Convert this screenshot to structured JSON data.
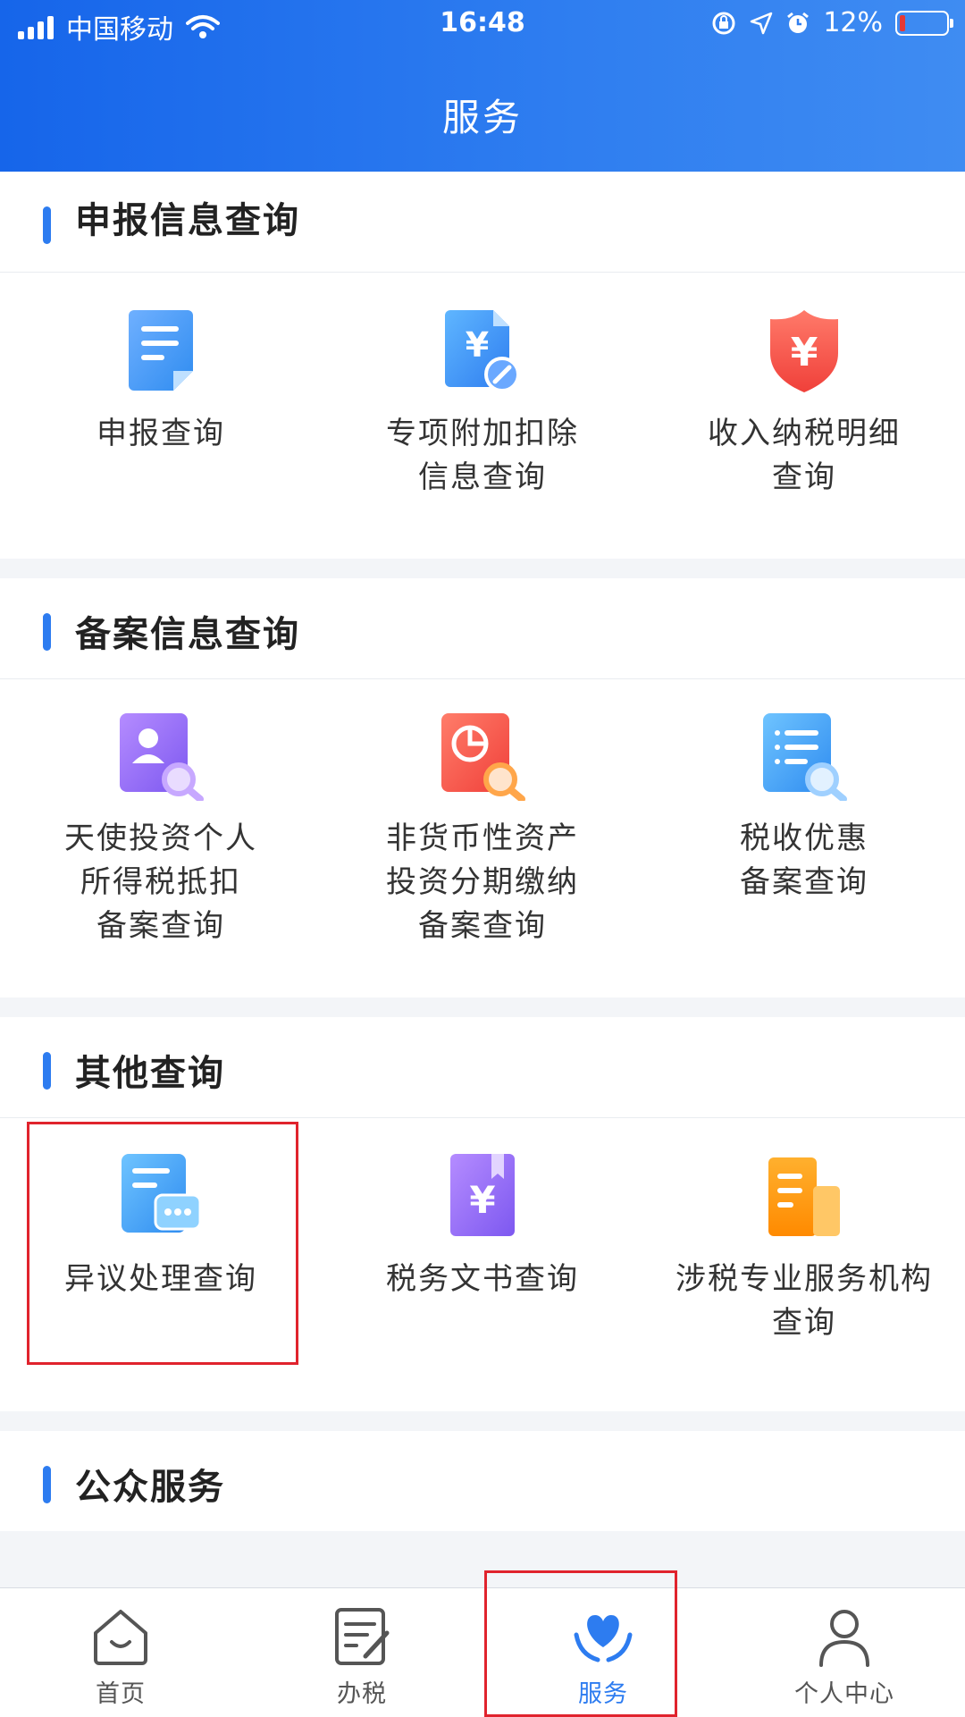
{
  "status_bar": {
    "carrier": "中国移动",
    "time": "16:48",
    "battery": "12%",
    "battery_level": 0.12
  },
  "header": {
    "title": "服务"
  },
  "sections": [
    {
      "title": "申报信息查询",
      "items": [
        {
          "label": "申报查询",
          "icon": "document-icon"
        },
        {
          "label": "专项附加扣除\n信息查询",
          "icon": "yuan-document-edit-icon"
        },
        {
          "label": "收入纳税明细\n查询",
          "icon": "yuan-shield-icon"
        }
      ]
    },
    {
      "title": "备案信息查询",
      "items": [
        {
          "label": "天使投资个人\n所得税抵扣\n备案查询",
          "icon": "person-search-icon"
        },
        {
          "label": "非货币性资产\n投资分期缴纳\n备案查询",
          "icon": "pie-chart-search-icon"
        },
        {
          "label": "税收优惠\n备案查询",
          "icon": "list-search-icon"
        }
      ]
    },
    {
      "title": "其他查询",
      "items": [
        {
          "label": "异议处理查询",
          "icon": "document-chat-icon"
        },
        {
          "label": "税务文书查询",
          "icon": "yuan-book-icon"
        },
        {
          "label": "涉税专业服务机构\n查询",
          "icon": "building-icon"
        }
      ]
    },
    {
      "title": "公众服务",
      "items": []
    }
  ],
  "tabbar": {
    "tabs": [
      {
        "label": "首页",
        "icon": "home-icon",
        "active": false
      },
      {
        "label": "办税",
        "icon": "edit-document-icon",
        "active": false
      },
      {
        "label": "服务",
        "icon": "heart-hands-icon",
        "active": true
      },
      {
        "label": "个人中心",
        "icon": "user-icon",
        "active": false
      }
    ]
  },
  "colors": {
    "accent": "#2d7cf0",
    "highlight_box": "#e0232d"
  }
}
